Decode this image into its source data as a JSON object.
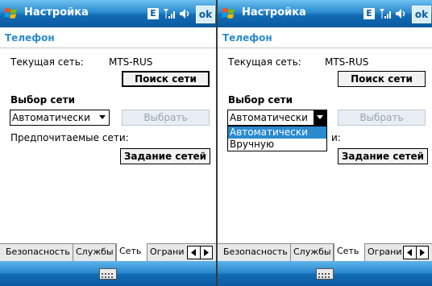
{
  "left": {
    "title": "Настройка",
    "status": {
      "e": "E",
      "ok": "ok"
    },
    "header": "Телефон",
    "current_network_label": "Текущая сеть:",
    "current_network_value": "MTS-RUS",
    "search_button": "Поиск сети",
    "network_selection_label": "Выбор сети",
    "mode_value": "Автоматически",
    "select_button": "Выбрать",
    "preferred_label": "Предпочитаемые сети:",
    "set_networks_button": "Задание сетей",
    "tabs": [
      "Безопасность",
      "Службы",
      "Сеть",
      "Ограни"
    ]
  },
  "right": {
    "title": "Настройка",
    "status": {
      "e": "E",
      "ok": "ok"
    },
    "header": "Телефон",
    "current_network_label": "Текущая сеть:",
    "current_network_value": "MTS-RUS",
    "search_button": "Поиск сети",
    "network_selection_label": "Выбор сети",
    "mode_value": "Автоматически",
    "select_button": "Выбрать",
    "preferred_label_tail": "и:",
    "set_networks_button": "Задание сетей",
    "dropdown_options": [
      "Автоматически",
      "Вручную"
    ],
    "tabs": [
      "Безопасность",
      "Службы",
      "Сеть",
      "Ограни"
    ]
  },
  "colors": {
    "accent": "#2a8ad0",
    "titlebar": "#0a5aa0"
  }
}
